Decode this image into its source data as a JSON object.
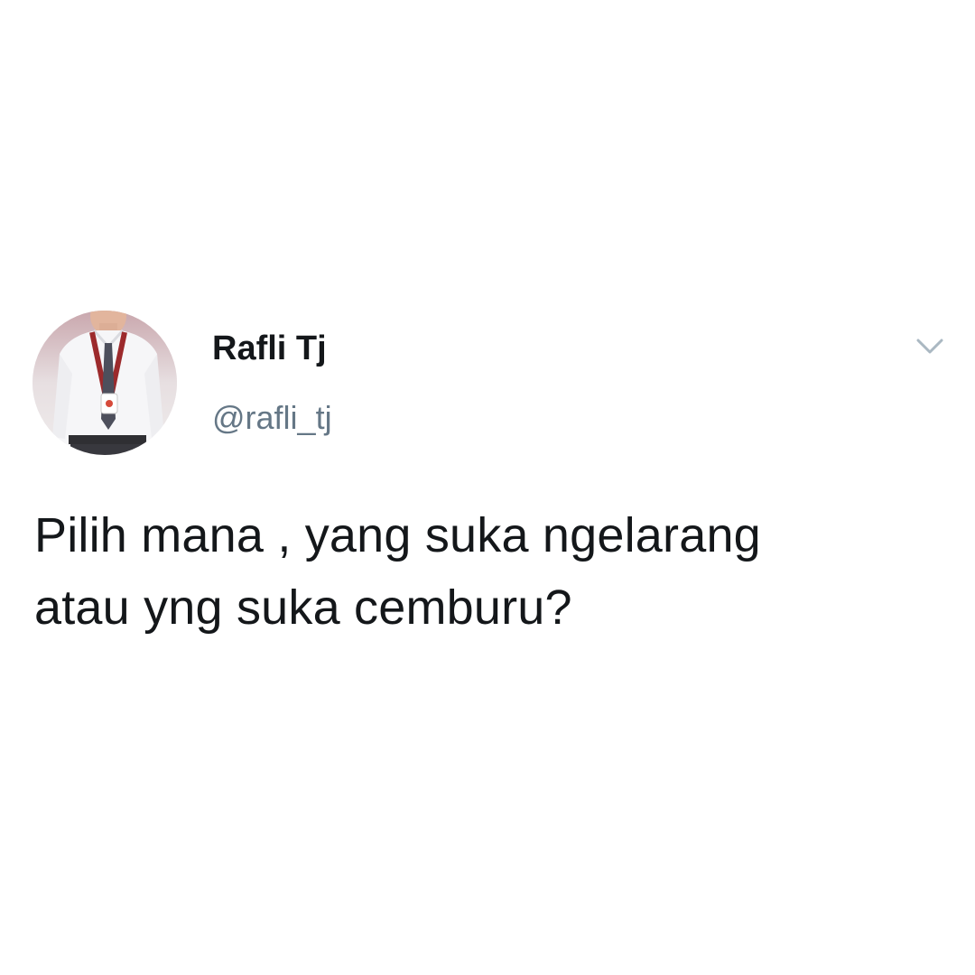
{
  "tweet": {
    "author": {
      "display_name": "Rafli Tj",
      "handle": "@rafli_tj",
      "avatar_icon": "profile-photo-avatar"
    },
    "text": "Pilih mana , yang suka ngelarang\natau yng suka cemburu?",
    "menu_icon": "chevron-down-icon"
  },
  "colors": {
    "background": "#ffffff",
    "text_primary": "#14171a",
    "text_secondary": "#657786",
    "caret": "#aab8c2"
  }
}
